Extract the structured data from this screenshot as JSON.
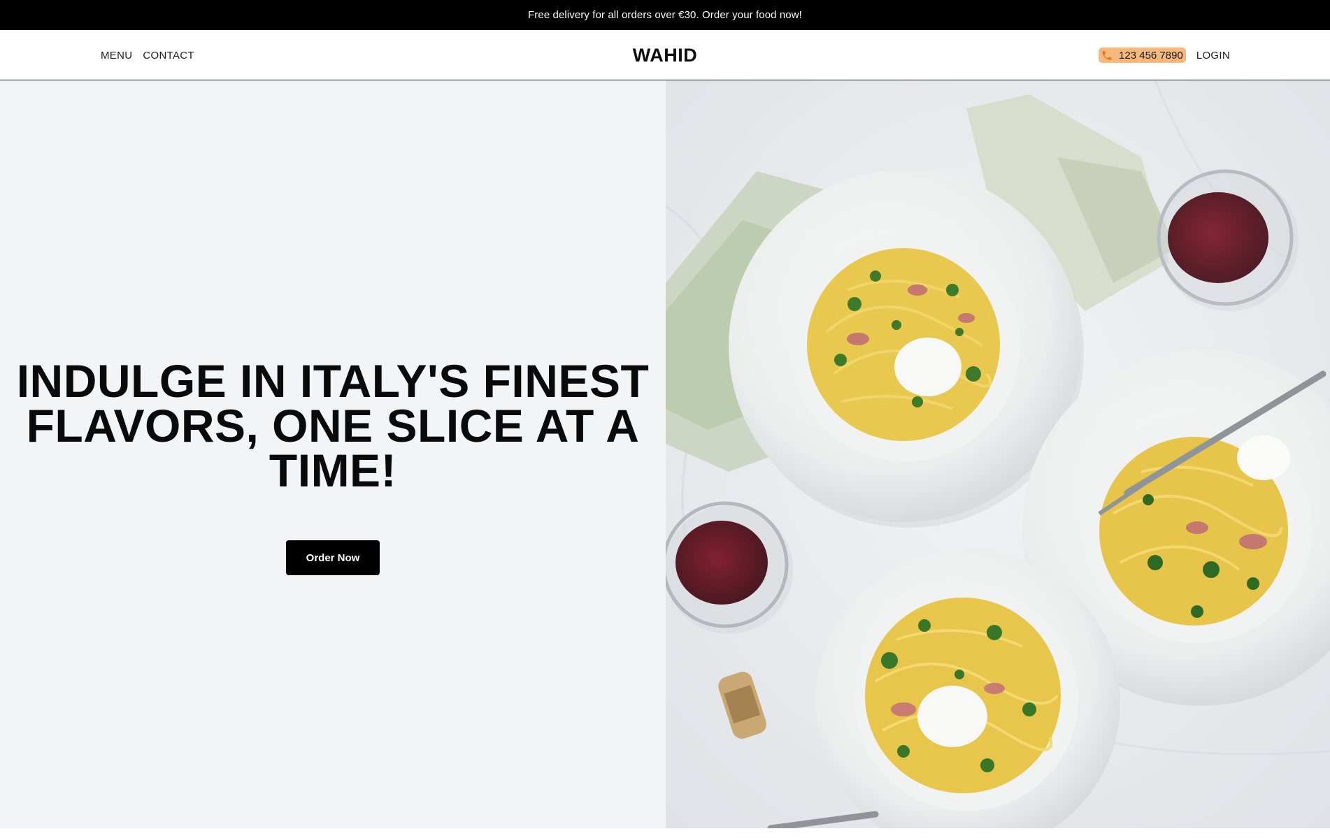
{
  "announcement": {
    "text": "Free delivery for all orders over €30. Order your food now!"
  },
  "header": {
    "nav_left": [
      {
        "label": "MENU"
      },
      {
        "label": "CONTACT"
      }
    ],
    "logo": "WAHID",
    "phone": {
      "icon": "phone-icon",
      "number": "123 456 7890"
    },
    "login_label": "LOGIN"
  },
  "hero": {
    "title": "INDULGE IN ITALY'S FINEST FLAVORS, ONE SLICE AT A TIME!",
    "cta_label": "Order Now",
    "image": "pasta-dishes-with-red-wine-photo"
  },
  "colors": {
    "announcement_bg": "#000000",
    "phone_pill_bg": "#f6b87c",
    "hero_left_bg": "#f3f4f6",
    "cta_bg": "#000000"
  }
}
